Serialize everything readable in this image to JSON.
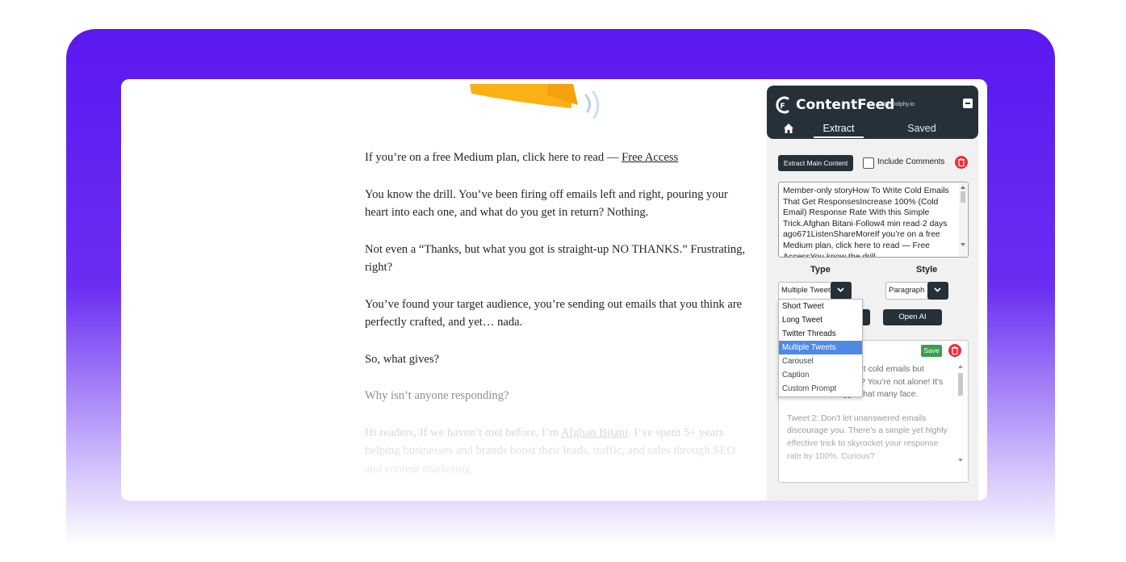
{
  "article": {
    "free_access_prefix": "If you’re on a free Medium plan, click here to read — ",
    "free_access_link": "Free Access",
    "p1": "You know the drill. You’ve been firing off emails left and right, pouring your heart into each one, and what do you get in return? Nothing.",
    "p2": "Not even a “Thanks, but what you got is straight-up NO THANKS.” Frustrating, right?",
    "p3": "You’ve found your target audience, you’re sending out emails that you think are perfectly crafted, and yet… nada.",
    "p4": "So, what gives?",
    "p5": "Why isn’t anyone responding?",
    "p6_prefix": "Hi readers, If we haven’t met before, I’m ",
    "p6_link": "Afghan Bitani",
    "p6_suffix": ". I’ve spent 5+ years helping businesses and brands boost their leads, traffic, and sales through SEO and content marketing."
  },
  "extension": {
    "brand": "ContentFeed",
    "by": "by Dolphy.io",
    "tabs": {
      "extract": "Extract",
      "saved": "Saved"
    },
    "extract_button": "Extract Main Content",
    "include_comments": "Include Comments",
    "include_comments_checked": false,
    "extracted_text": "Member-only storyHow To Write Cold Emails That Get ResponsesIncrease 100% (Cold Email) Response Rate With this Simple Trick.Afghan Bitani·Follow4 min read·2 days ago671ListenShareMoreIf you’re on a free Medium plan, click here to read — Free AccessYou know the drill.",
    "type_label": "Type",
    "style_label": "Style",
    "type_selected": "Multiple Tweets",
    "style_selected": "Paragraph",
    "type_options": [
      "Short Tweet",
      "Long Tweet",
      "Twitter Threads",
      "Multiple Tweets",
      "Carousel",
      "Caption",
      "Custom Prompt"
    ],
    "open_ai_button": "Open AI",
    "save_button": "Save",
    "output_tweet1": "Tweet 1: Sending out cold emails but getting no response? You’re not alone! It's a common struggle that many face.",
    "output_tweet2": "Tweet 2: Don't let unanswered emails discourage you. There's a simple yet highly effective trick to skyrocket your response rate by 100%. Curious?"
  },
  "colors": {
    "purple": "#5b18f0",
    "panel_dark": "#253039",
    "danger": "#e4313f",
    "success": "#3aa04a",
    "selection": "#4e8ae3"
  }
}
